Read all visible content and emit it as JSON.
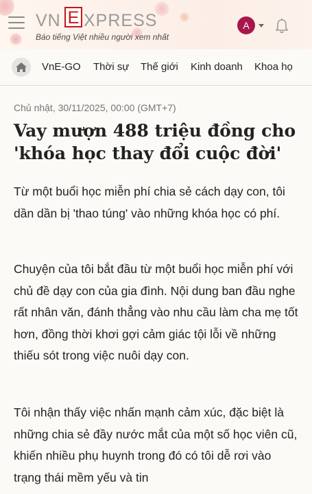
{
  "header": {
    "logo_prefix": "VN",
    "logo_e": "E",
    "logo_suffix": "XPRESS",
    "tagline": "Báo tiếng Việt nhiều người xem nhất",
    "avatar_letter": "A",
    "menu_icon": "hamburger-icon",
    "notification_icon": "bell-icon"
  },
  "nav": {
    "home_icon": "home-icon",
    "items": [
      "VnE-GO",
      "Thời sự",
      "Thế giới",
      "Kinh doanh",
      "Khoa họ"
    ]
  },
  "article": {
    "meta": "Chủ nhật, 30/11/2025, 00:00 (GMT+7)",
    "title": "Vay mượn 488 triệu đồng cho 'khóa học thay đổi cuộc đời'",
    "paragraphs": [
      "Từ một buổi học miễn phí chia sẻ cách dạy con, tôi dần dần bị 'thao túng' vào những khóa học có phí.",
      "Chuyện của tôi bắt đầu từ một buổi học miễn phí với chủ đề dạy con của gia đình. Nội dung ban đầu nghe rất nhân văn, đánh thẳng vào nhu cầu làm cha mẹ tốt hơn, đồng thời khơi gợi cảm giác tội lỗi về những thiếu sót trong việc nuôi dạy con.",
      "Tôi nhận thấy việc nhấn mạnh cảm xúc, đặc biệt là những chia sẻ đầy nước mắt của một số học viên cũ, khiến nhiều phụ huynh trong đó có tôi dễ rơi vào trạng thái mềm yếu và tin"
    ]
  },
  "colors": {
    "brand_red": "#c4161c",
    "avatar_bg": "#a8174b",
    "page_bg": "#fcfaf6"
  }
}
